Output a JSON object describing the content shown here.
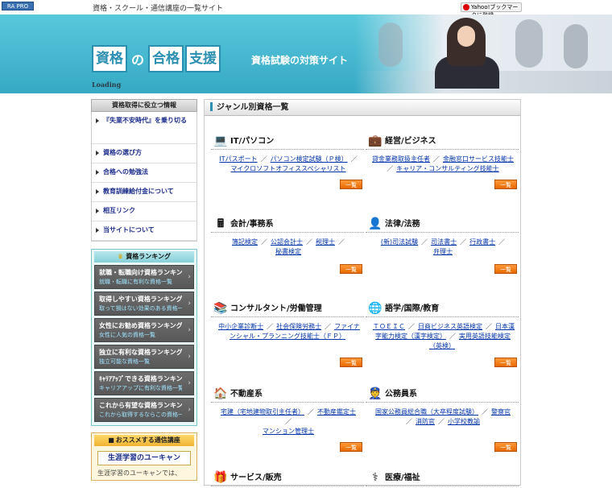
{
  "top": {
    "badge": "RA PRO",
    "tagline": "資格・スクール・通信講座の一覧サイト",
    "yahoo_button": "Yahoo!ブックマークに登録"
  },
  "header": {
    "logo": [
      "資格",
      "の",
      "合格",
      "支援"
    ],
    "subtitle": "資格試験の対策サイト",
    "loading": "Loading"
  },
  "sidebar": {
    "title": "資格取得に役立つ情報",
    "items": [
      {
        "label": "『失業不安時代』を乗り切る"
      },
      {
        "label": "資格の選び方"
      },
      {
        "label": "合格への勉強法"
      },
      {
        "label": "教育訓練給付金について"
      },
      {
        "label": "相互リンク"
      },
      {
        "label": "当サイトについて"
      }
    ],
    "ranking": {
      "title": "資格ランキング",
      "items": [
        {
          "title": "就職・転職向け資格ランキング",
          "sub": "就職・転職に有利な資格一覧"
        },
        {
          "title": "取得しやすい資格ランキング",
          "sub": "取って損はない効果のある資格一覧"
        },
        {
          "title": "女性にお勧め資格ランキング",
          "sub": "女性に人気の資格一覧"
        },
        {
          "title": "独立に有利な資格ランキング",
          "sub": "独立可能な資格一覧"
        },
        {
          "title": "ｷｬﾘｱｱｯﾌﾟできる資格ランキング",
          "sub": "キャリアアップに有利な資格一覧"
        },
        {
          "title": "これから有望な資格ランキング",
          "sub": "これから取得するならこの資格一覧"
        }
      ]
    },
    "correspondence": {
      "title": "おススメする通信講座",
      "button": "生涯学習のユーキャン",
      "text": "生涯学習のユーキャンでは、"
    }
  },
  "main": {
    "title": "ジャンル別資格一覧",
    "more_label": "一覧",
    "categories": [
      {
        "name": "IT/パソコン",
        "icon": "computer-icon",
        "links": [
          "ITパスポート",
          "パソコン検定試験（Ｐ検）",
          "マイクロソフトオフィススペシャリスト"
        ]
      },
      {
        "name": "経営/ビジネス",
        "icon": "briefcase-icon",
        "links": [
          "貸金業務取扱主任者",
          "金融窓口サービス技能士",
          "キャリア・コンサルティング技能士"
        ]
      },
      {
        "name": "会計/事務系",
        "icon": "calculator-icon",
        "links": [
          "簿記検定",
          "公認会計士",
          "税理士",
          "秘書検定"
        ]
      },
      {
        "name": "法律/法務",
        "icon": "lawyer-icon",
        "links": [
          "(新)司法試験",
          "司法書士",
          "行政書士",
          "弁理士"
        ]
      },
      {
        "name": "コンサルタント/労働管理",
        "icon": "books-icon",
        "links": [
          "中小企業診断士",
          "社会保険労務士",
          "ファイナンシャル・プランニング技能士（ＦＰ）"
        ]
      },
      {
        "name": "語学/国際/教育",
        "icon": "globe-icon",
        "links": [
          "ＴＯＥＩＣ",
          "日商ビジネス英語検定",
          "日本漢字能力検定（漢字検定）",
          "実用英語技能検定（英検）"
        ]
      },
      {
        "name": "不動産系",
        "icon": "house-icon",
        "links": [
          "宅建（宅地建物取引主任者）",
          "不動産鑑定士",
          "マンション管理士"
        ]
      },
      {
        "name": "公務員系",
        "icon": "officer-icon",
        "links": [
          "国家公務員総合職（大卒程度試験）",
          "警察官",
          "消防官",
          "小学校教諭"
        ]
      },
      {
        "name": "サービス/販売",
        "icon": "gift-icon",
        "links": []
      },
      {
        "name": "医療/福祉",
        "icon": "nurse-icon",
        "links": []
      }
    ]
  },
  "colors": {
    "header": "#36a9c4",
    "more_button": "#e86a00",
    "link": "#0033aa"
  }
}
